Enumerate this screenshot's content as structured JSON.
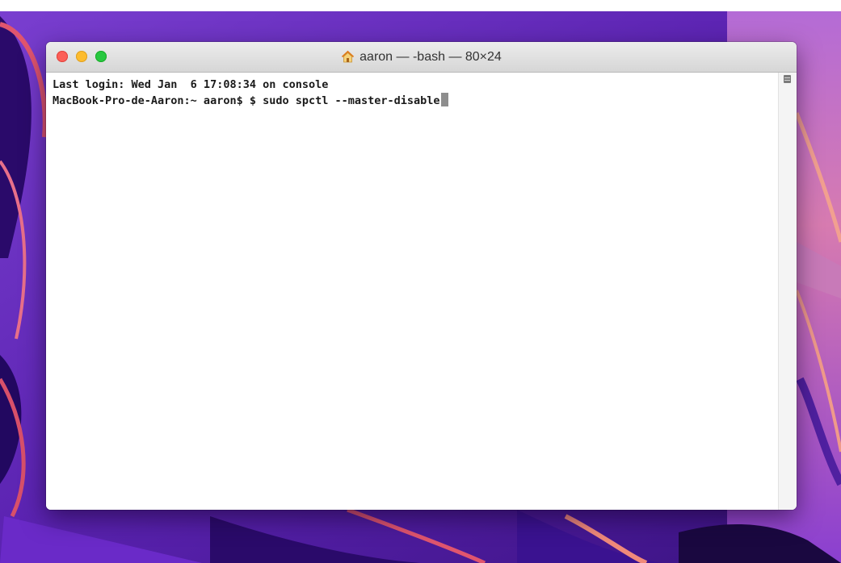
{
  "window": {
    "title": "aaron — -bash — 80×24",
    "title_icon": "home-icon",
    "controls": {
      "close_color": "#fc5f57",
      "minimize_color": "#fdbc2e",
      "zoom_color": "#28c840"
    }
  },
  "terminal": {
    "lines": [
      "Last login: Wed Jan  6 17:08:34 on console",
      "MacBook-Pro-de-Aaron:~ aaron$ $ sudo spctl --master-disable"
    ],
    "cursor": "block"
  },
  "scrollbar": {
    "icon": "scroll-indicator-icon"
  },
  "colors": {
    "wallpaper_base": "#5a1fa8",
    "wallpaper_accent": "#e0556e"
  }
}
